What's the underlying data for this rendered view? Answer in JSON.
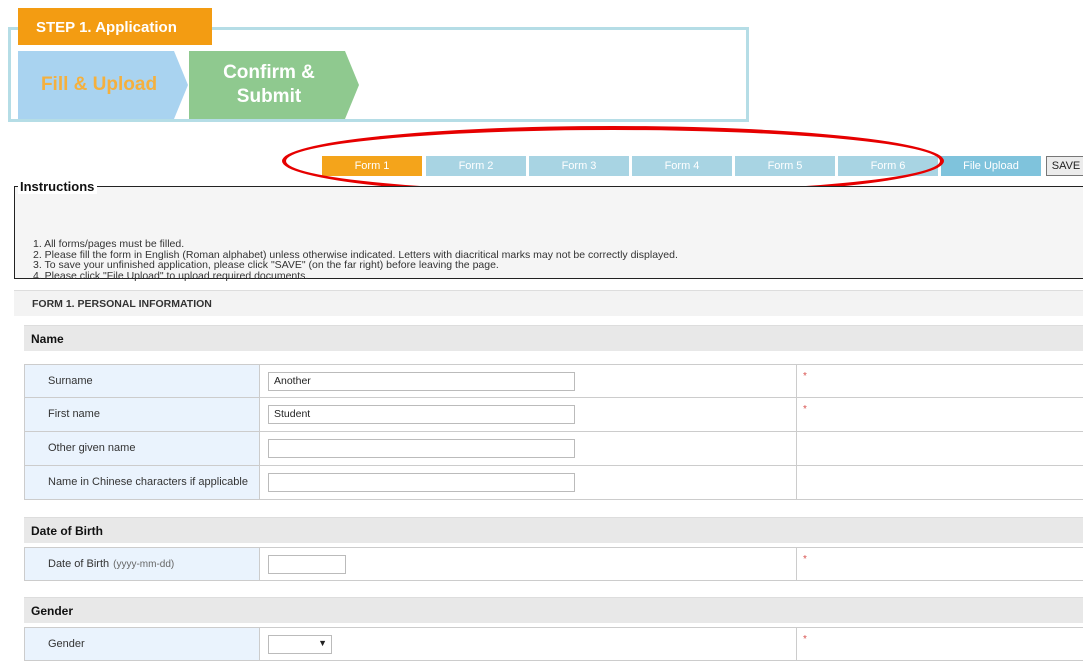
{
  "step": {
    "label": "STEP 1. Application",
    "stages": [
      "Fill & Upload",
      "Confirm &\nSubmit"
    ]
  },
  "tabs": [
    "Form 1",
    "Form 2",
    "Form 3",
    "Form 4",
    "Form 5",
    "Form 6",
    "File Upload"
  ],
  "active_tab": "Form 1",
  "save_label": "SAVE",
  "instructions": {
    "legend": "Instructions",
    "items": [
      "1. All forms/pages must be filled.",
      "2. Please fill the form in English (Roman alphabet) unless otherwise indicated. Letters with diacritical marks may not be correctly displayed.",
      "3. To save your unfinished application, please click \"SAVE\" (on the far right) before leaving the page.",
      "4. Please click \"File Upload\" to upload required documents."
    ]
  },
  "section_title": "FORM 1. PERSONAL INFORMATION",
  "groups": {
    "name": {
      "title": "Name",
      "surname_label": "Surname",
      "surname_value": "Another",
      "first_label": "First name",
      "first_value": "Student",
      "other_label": "Other given name",
      "other_value": "",
      "chinese_label": "Name in Chinese characters if applicable",
      "chinese_value": ""
    },
    "dob": {
      "title": "Date of Birth",
      "label": "Date of Birth",
      "hint": "(yyyy-mm-dd)",
      "value": ""
    },
    "gender": {
      "title": "Gender",
      "label": "Gender",
      "value": ""
    }
  },
  "required_mark": "*",
  "colors": {
    "step_label": "#f39c12",
    "stage_fill": "#a9d3f0",
    "stage_confirm": "#8fc98f",
    "tab_active": "#f4a41b",
    "tab_inactive": "#a8d4e3",
    "annotation_ellipse": "#e60000"
  }
}
